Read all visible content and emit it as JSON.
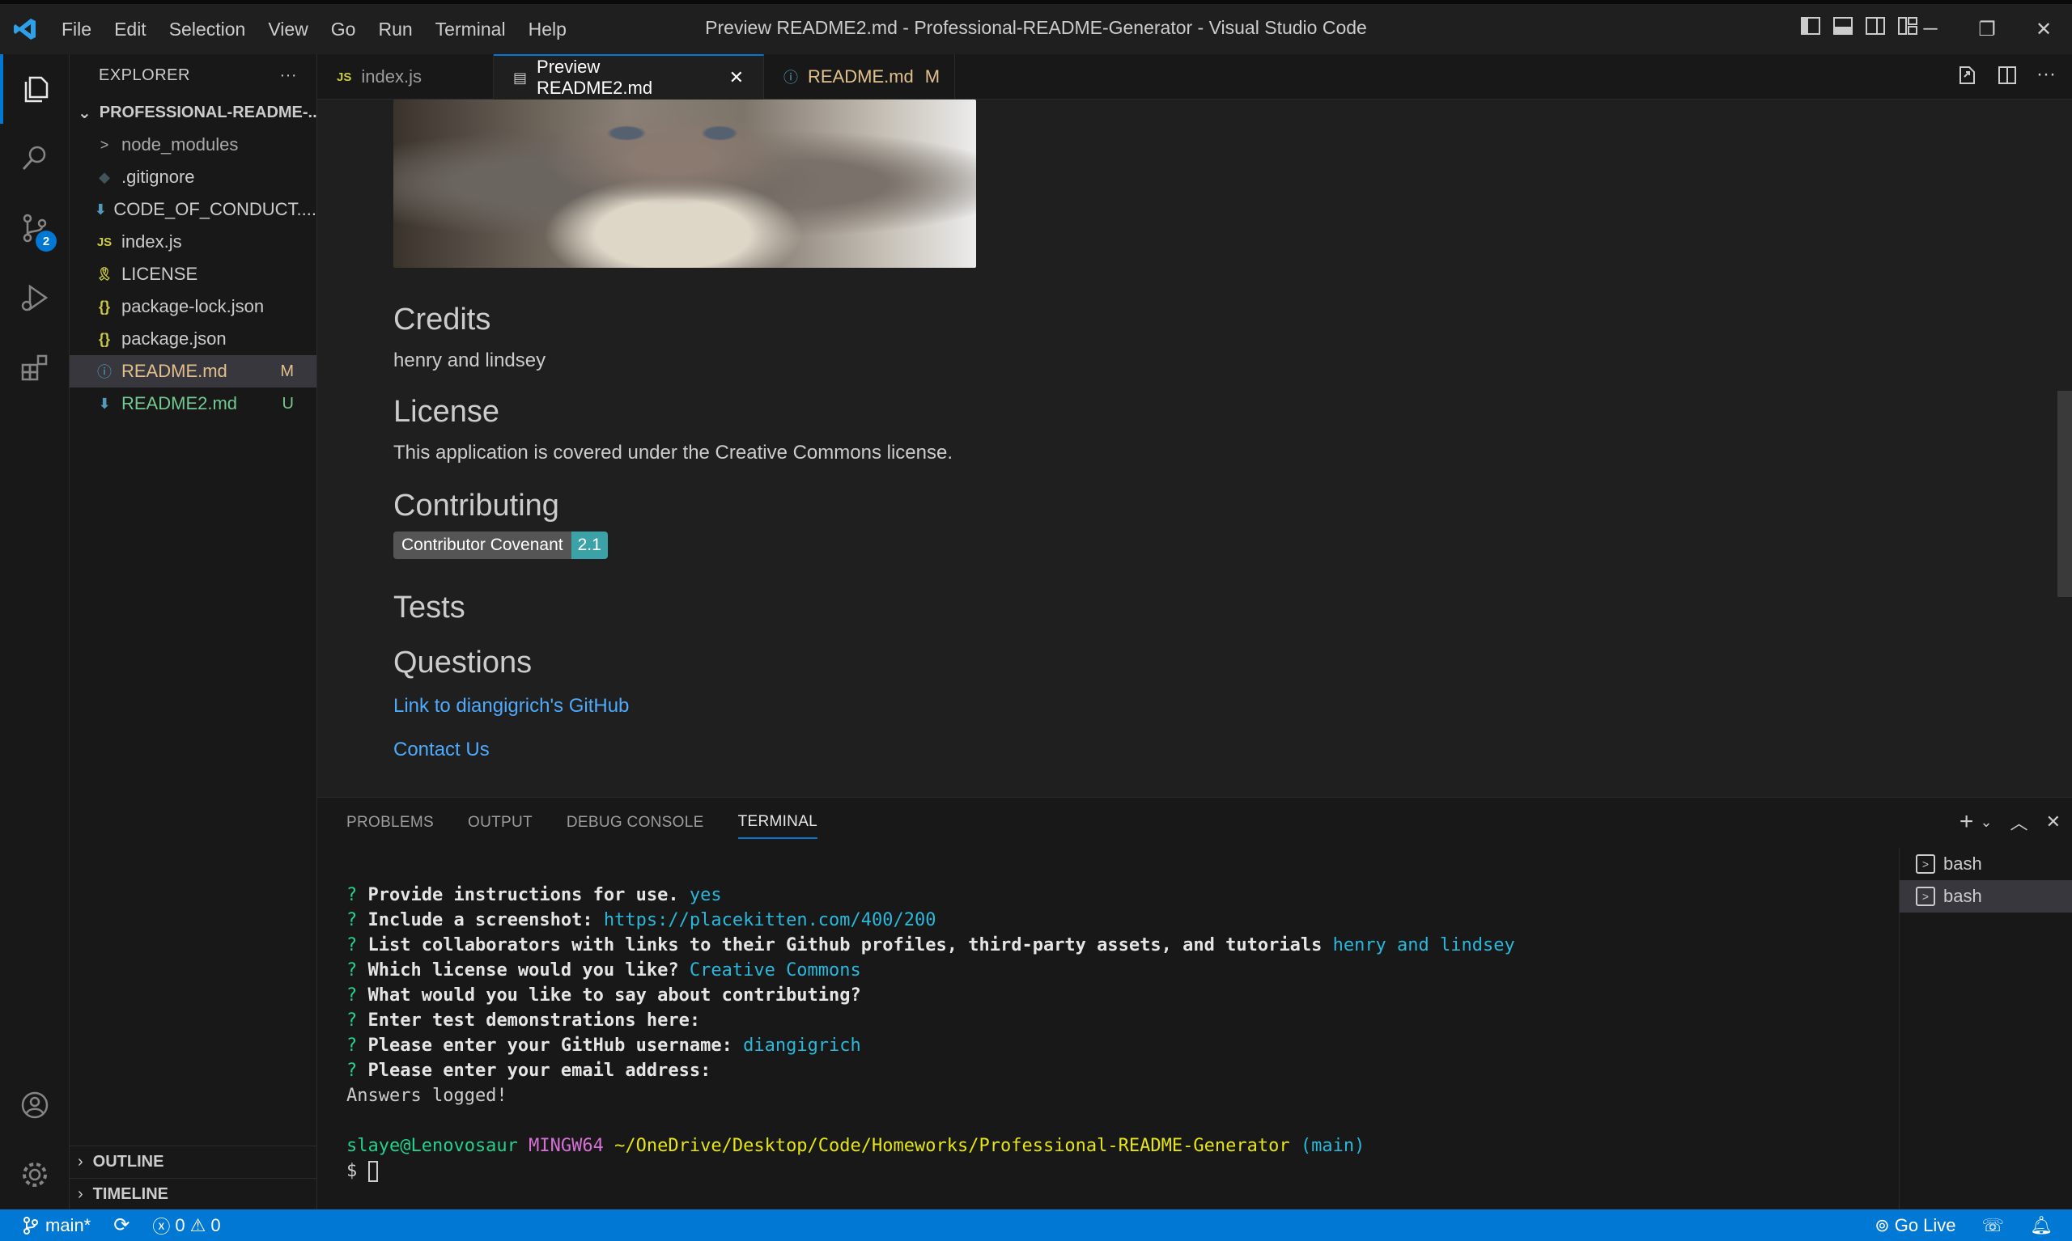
{
  "window": {
    "title": "Preview README2.md - Professional-README-Generator - Visual Studio Code",
    "menu": [
      "File",
      "Edit",
      "Selection",
      "View",
      "Go",
      "Run",
      "Terminal",
      "Help"
    ]
  },
  "activity": {
    "scm_badge": "2"
  },
  "sidebar": {
    "header": "EXPLORER",
    "folder": "PROFESSIONAL-README-...",
    "items": [
      {
        "icon": ">",
        "label": "node_modules",
        "status": ""
      },
      {
        "icon": "◆",
        "label": ".gitignore",
        "status": ""
      },
      {
        "icon": "⬇",
        "label": "CODE_OF_CONDUCT....",
        "status": ""
      },
      {
        "icon": "JS",
        "label": "index.js",
        "status": ""
      },
      {
        "icon": "🎗",
        "label": "LICENSE",
        "status": ""
      },
      {
        "icon": "{}",
        "label": "package-lock.json",
        "status": ""
      },
      {
        "icon": "{}",
        "label": "package.json",
        "status": ""
      },
      {
        "icon": "ⓘ",
        "label": "README.md",
        "status": "M"
      },
      {
        "icon": "⬇",
        "label": "README2.md",
        "status": "U"
      }
    ],
    "outline": "OUTLINE",
    "timeline": "TIMELINE"
  },
  "tabs": [
    {
      "icon": "JS",
      "label": "index.js",
      "extra": ""
    },
    {
      "icon": "▤",
      "label": "Preview README2.md",
      "extra": "✕"
    },
    {
      "icon": "ⓘ",
      "label": "README.md",
      "extra": "M"
    }
  ],
  "preview": {
    "credits_heading": "Credits",
    "credits_text": "henry and lindsey",
    "license_heading": "License",
    "license_text": "This application is covered under the Creative Commons license.",
    "contributing_heading": "Contributing",
    "badge_left": "Contributor Covenant",
    "badge_right": "2.1",
    "tests_heading": "Tests",
    "questions_heading": "Questions",
    "github_link": "Link to diangigrich's GitHub",
    "contact_link": "Contact Us"
  },
  "panel": {
    "tabs": [
      "PROBLEMS",
      "OUTPUT",
      "DEBUG CONSOLE",
      "TERMINAL"
    ],
    "active_tab": "TERMINAL",
    "terminals": [
      "bash",
      "bash"
    ]
  },
  "terminal": {
    "lines": [
      {
        "q": "Provide instructions for use.",
        "a": "yes"
      },
      {
        "q": "Include a screenshot:",
        "a": "https://placekitten.com/400/200"
      },
      {
        "q": "List collaborators with links to their Github profiles, third-party assets, and tutorials",
        "a": "henry and lindsey"
      },
      {
        "q": "Which license would you like?",
        "a": "Creative Commons"
      },
      {
        "q": "What would you like to say about contributing?",
        "a": ""
      },
      {
        "q": "Enter test demonstrations here:",
        "a": ""
      },
      {
        "q": "Please enter your GitHub username:",
        "a": "diangigrich"
      },
      {
        "q": "Please enter your email address:",
        "a": ""
      }
    ],
    "logged": "Answers logged!",
    "prompt_user": "slaye@Lenovosaur",
    "prompt_host": "MINGW64",
    "prompt_path": "~/OneDrive/Desktop/Code/Homeworks/Professional-README-Generator",
    "prompt_branch": "(main)",
    "prompt_symbol": "$"
  },
  "statusbar": {
    "branch": "main*",
    "errors": "0",
    "warnings": "0",
    "golive": "Go Live"
  },
  "colors": {
    "accent": "#0078d4",
    "link": "#4daafc",
    "modified": "#e2c08d",
    "untracked": "#73c991"
  }
}
